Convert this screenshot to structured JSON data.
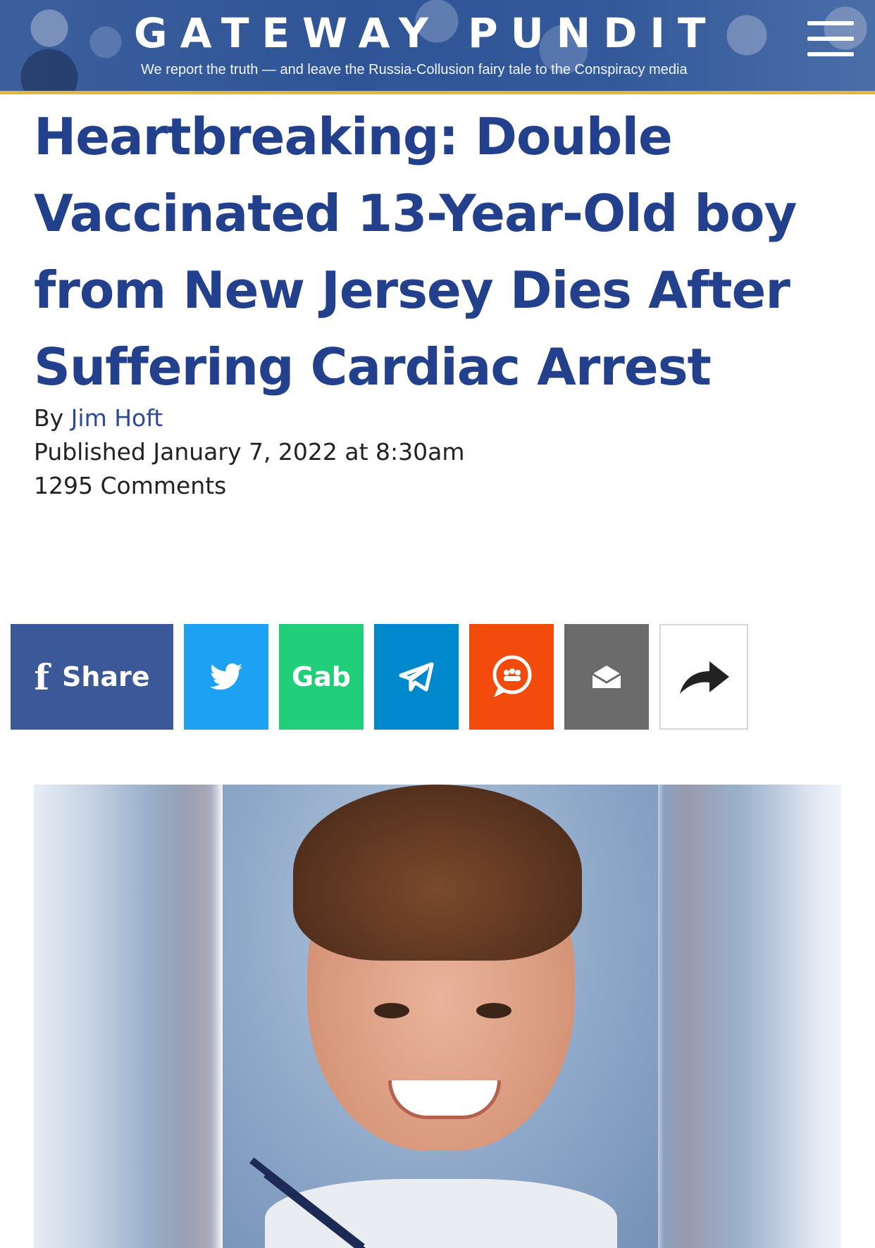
{
  "header": {
    "brand": "GATEWAY PUNDIT",
    "tagline": "We report the truth — and leave the Russia-Collusion fairy tale to the Conspiracy media",
    "accent_color": "#e4b441",
    "menu_icon": "hamburger-menu-icon"
  },
  "article": {
    "title": "Heartbreaking: Double Vaccinated 13-Year-Old boy from New Jersey Dies After Suffering Cardiac Arrest",
    "byline_prefix": "By",
    "author": "Jim Hoft",
    "published": "Published January 7, 2022 at 8:30am",
    "comments": "1295 Comments",
    "title_color": "#22408c"
  },
  "share": {
    "facebook_label": "Share",
    "gab_label": "Gab",
    "icons": [
      "facebook-icon",
      "twitter-icon",
      "telegram-icon",
      "mewe-icon",
      "email-icon",
      "share-arrow-icon"
    ],
    "colors": {
      "facebook": "#3b5998",
      "twitter": "#1da1f2",
      "gab": "#21cf7a",
      "telegram": "#0088cc",
      "mewe": "#f34b0c",
      "email": "#6b6b6b"
    }
  }
}
